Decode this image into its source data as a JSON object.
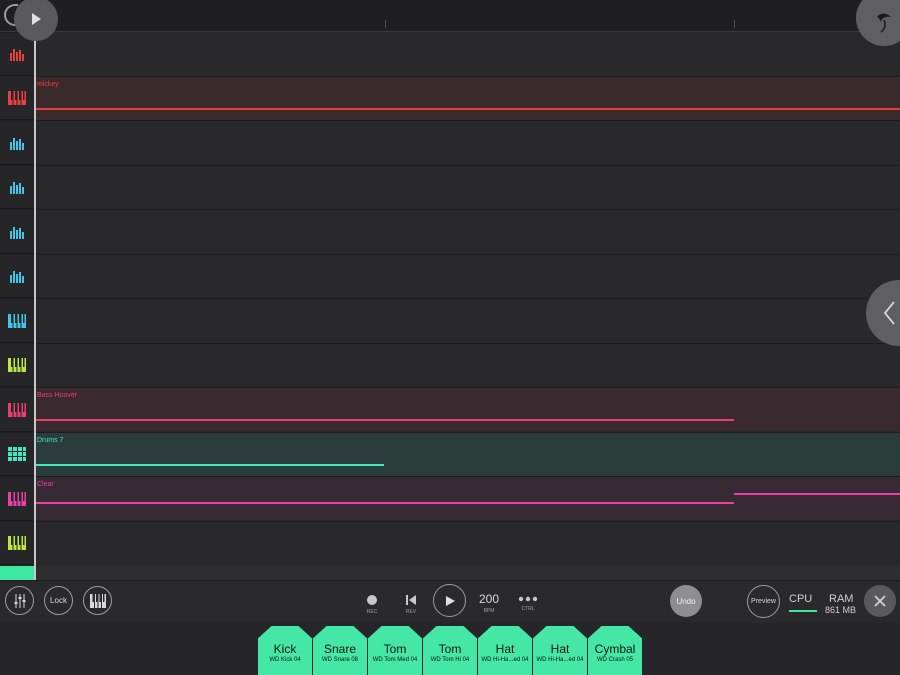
{
  "sidebar": {
    "tracks": [
      {
        "icon": "bars-icon",
        "color": "#e8403f"
      },
      {
        "icon": "keys-icon",
        "color": "#e8403f"
      },
      {
        "icon": "bars-icon",
        "color": "#3fc6e8"
      },
      {
        "icon": "bars-icon",
        "color": "#3fc6e8"
      },
      {
        "icon": "bars-icon",
        "color": "#3fc6e8"
      },
      {
        "icon": "bars-icon",
        "color": "#3fc6e8"
      },
      {
        "icon": "keys-icon",
        "color": "#3fc6e8"
      },
      {
        "icon": "keys-icon",
        "color": "#b6e83f"
      },
      {
        "icon": "keys-icon",
        "color": "#e83f6e"
      },
      {
        "icon": "grid-icon",
        "color": "#3fe8c0"
      },
      {
        "icon": "keys-icon",
        "color": "#e83fa8"
      },
      {
        "icon": "keys-icon",
        "color": "#b6e83f"
      }
    ]
  },
  "playlist": {
    "clips": [
      {
        "name": "mickey",
        "color": "#e8403f",
        "fill": "#3a2a2c"
      },
      {
        "name": "Bass Hoover",
        "color": "#e83f6e",
        "fill": "#3a2a2f"
      },
      {
        "name": "Drums 7",
        "color": "#3fe8c0",
        "fill": "#2a3d3b"
      },
      {
        "name": "Clear",
        "color": "#e83fa8",
        "fill": "#382a33"
      }
    ]
  },
  "transport": {
    "lock_label": "Lock",
    "rec_caption": "REC",
    "rev_caption": "REV",
    "bpm_value": "200",
    "bpm_caption": "BPM",
    "ctrl_caption": "CTRL",
    "undo_label": "Undo",
    "preview_label": "Preview",
    "cpu_label": "CPU",
    "ram_label": "RAM",
    "ram_value": "861 MB"
  },
  "pads": [
    {
      "name": "Kick",
      "sample": "WD Kick 04"
    },
    {
      "name": "Snare",
      "sample": "WD Snare 08"
    },
    {
      "name": "Tom",
      "sample": "WD Tom Med 04"
    },
    {
      "name": "Tom",
      "sample": "WD Tom Hi 04"
    },
    {
      "name": "Hat",
      "sample": "WD Hi-Ha...ed 04"
    },
    {
      "name": "Hat",
      "sample": "WD Hi-Ha...ed 04"
    },
    {
      "name": "Cymbal",
      "sample": "WD Crash 05"
    }
  ],
  "colors": {
    "accent": "#44e7a5",
    "background": "#29292c"
  }
}
